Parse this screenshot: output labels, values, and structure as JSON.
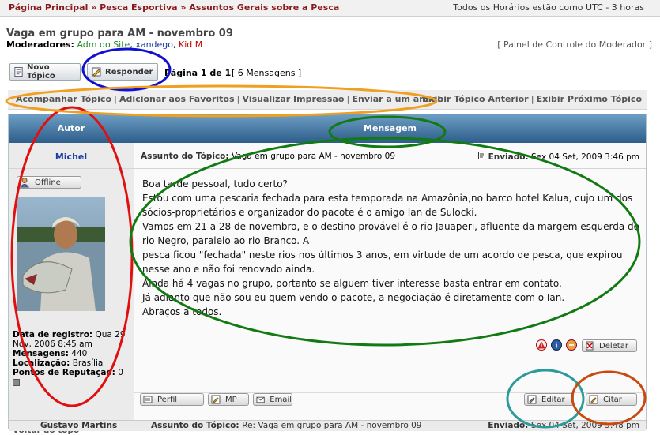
{
  "breadcrumb": {
    "items": [
      "Página Principal",
      "Pesca Esportiva",
      "Assuntos Gerais sobre a Pesca"
    ],
    "separator": "»"
  },
  "timezone": "Todos os Horários estão como UTC - 3 horas",
  "topic": {
    "title": "Vaga em grupo para AM - novembro 09"
  },
  "moderators": {
    "label": "Moderadores:",
    "names": [
      "Adm do Site",
      "xandego",
      "Kid M"
    ]
  },
  "mod_panel": "[ Painel de Controle do Moderador ]",
  "actions": {
    "new_topic": "Novo Tópico",
    "reply": "Responder",
    "page_info": "Página 1 de 1",
    "msg_count": "[ 6 Mensagens ]"
  },
  "toolbar": {
    "left": [
      "Acompanhar Tópico",
      "Adicionar aos Favoritos",
      "Visualizar Impressão",
      "Enviar a um amigo"
    ],
    "right": [
      "Exibir Tópico Anterior",
      "Exibir Próximo Tópico"
    ],
    "sep": "|"
  },
  "table": {
    "col_author": "Autor",
    "col_message": "Mensagem"
  },
  "post": {
    "author": "Michel",
    "status": "Offline",
    "subject_label": "Assunto do Tópico:",
    "subject": "Vaga em grupo para AM - novembro 09",
    "sent_label": "Enviado:",
    "sent": "Sex 04 Set, 2009 3:46 pm",
    "reg_label": "Data de registro:",
    "reg": "Qua 29 Nov, 2006 8:45 am",
    "posts_label": "Mensagens:",
    "posts": "440",
    "loc_label": "Localização:",
    "loc": "Brasília",
    "rep_label": "Pontos de Reputação:",
    "rep": "0",
    "body": [
      "Boa tarde pessoal, tudo certo?",
      "Estou com uma pescaria fechada para esta temporada na Amazônia,no barco hotel Kalua, cujo um dos sócios-proprietários e organizador do pacote é o amigo Ian de Sulocki.",
      "Vamos em 21 a 28 de novembro, e o destino provável é o rio Jauaperi, afluente da margem esquerda do rio Negro, paralelo ao rio Branco. A",
      "pesca ficou \"fechada\" neste rios nos últimos 3 anos, em virtude de um acordo de pesca, que expirou nesse ano e não foi renovado ainda.",
      "Ainda há 4 vagas no grupo, portanto se alguem tiver interesse basta entrar em contato.",
      "Já adianto que não sou eu quem vendo o pacote, a negociação é diretamente com o Ian.",
      "Abraços a todos."
    ],
    "delete": "Deletar",
    "profile": "Perfil",
    "pm": "MP",
    "email": "Email",
    "edit": "Editar",
    "quote": "Citar",
    "back_top": "Voltar ao topo"
  },
  "next_post": {
    "author": "Gustavo Martins",
    "subject_label": "Assunto do Tópico:",
    "subject": "Re: Vaga em grupo para AM - novembro 09",
    "sent_label": "Enviado:",
    "sent": "Sex 04 Set, 2009 5:48 pm"
  },
  "colors": {
    "header_blue": "#2d5d8a",
    "crumb_red": "#8b1a1a",
    "annot_red": "#e01010",
    "annot_blue": "#1010d0",
    "annot_orange": "#f0a020",
    "annot_green": "#137a13",
    "annot_teal": "#2a9a9a",
    "annot_brown": "#c84a10"
  }
}
